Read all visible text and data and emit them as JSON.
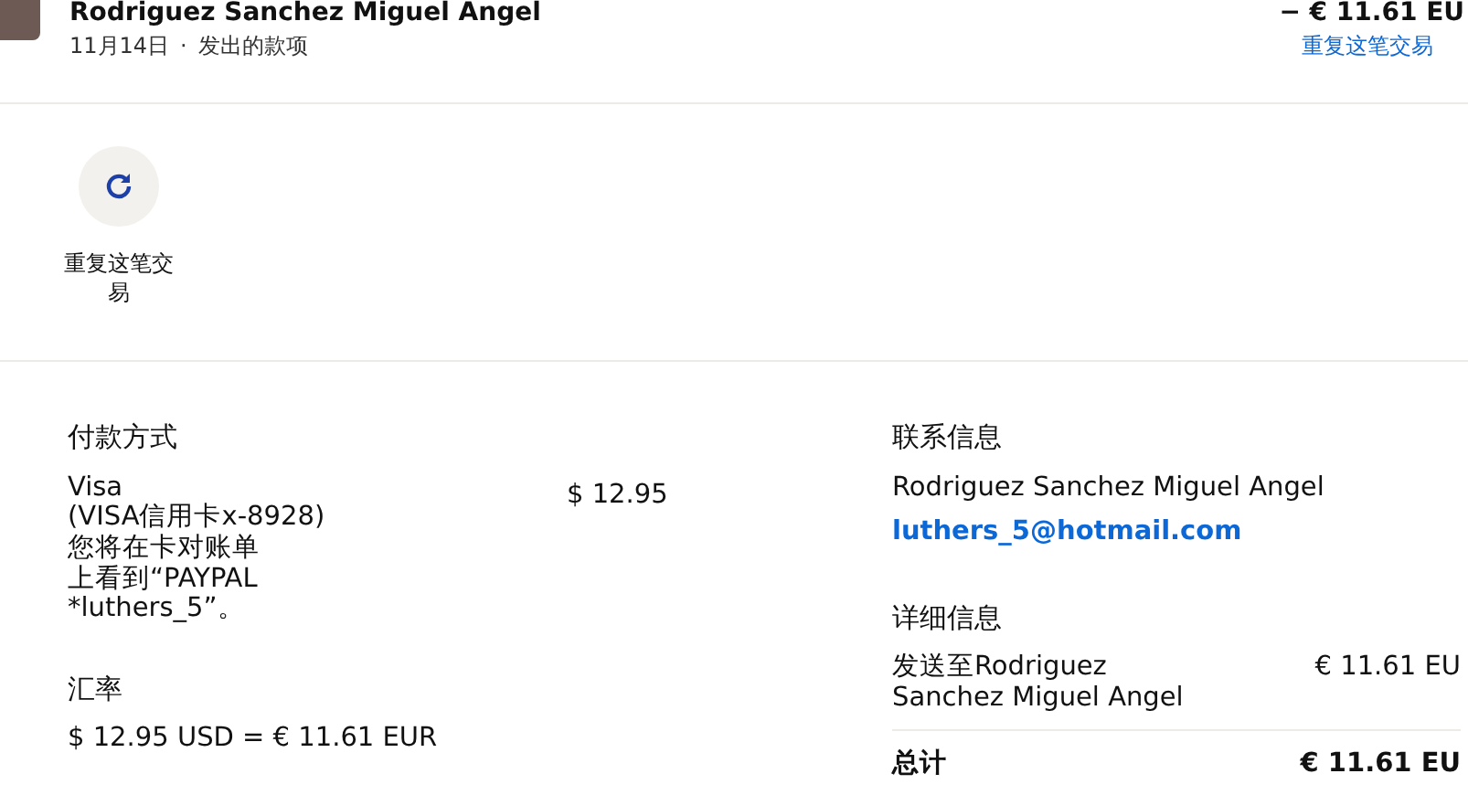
{
  "header": {
    "name": "Rodriguez Sanchez Miguel Angel",
    "date": "11月14日",
    "separator": "·",
    "type": "发出的款项",
    "amount": "− € 11.61 EU",
    "repeat_link": "重复这笔交易"
  },
  "actions": [
    {
      "label": "重复这笔交易"
    }
  ],
  "payment": {
    "title": "付款方式",
    "method_lines": [
      "Visa",
      "(VISA信用卡x-8928)",
      "您将在卡对账单",
      "上看到“PAYPAL",
      "*luthers_5”。"
    ],
    "amount": "$ 12.95"
  },
  "exchange": {
    "title": "汇率",
    "rate": "$ 12.95 USD = € 11.61 EUR"
  },
  "contact": {
    "title": "联系信息",
    "name": "Rodriguez Sanchez Miguel Angel",
    "email": "luthers_5@hotmail.com"
  },
  "details": {
    "title": "详细信息",
    "rows": [
      {
        "label": "发送至Rodriguez Sanchez Miguel Angel",
        "amount": "€ 11.61 EU"
      }
    ],
    "total_label": "总计",
    "total_amount": "€ 11.61 EU"
  }
}
